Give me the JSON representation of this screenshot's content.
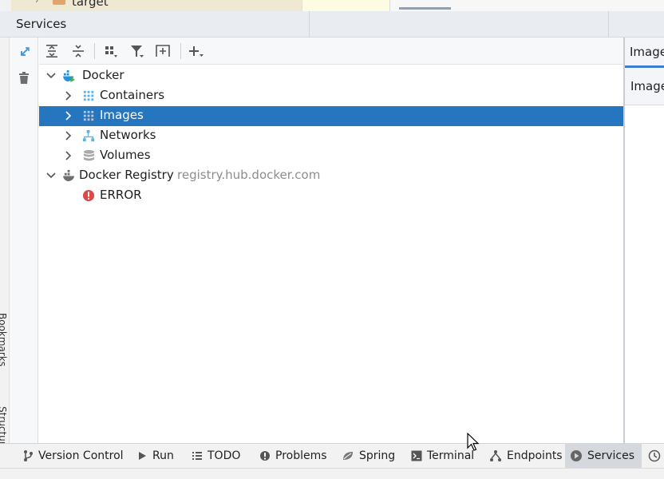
{
  "top_strip": {
    "folder_label": "target"
  },
  "services": {
    "title": "Services"
  },
  "left_stripe": {
    "bookmarks_label": "Bookmarks",
    "structure_label": "Structure"
  },
  "toolbar": {
    "buttons": [
      "expand-all",
      "collapse-all",
      "group-services",
      "filter",
      "new-service",
      "add"
    ]
  },
  "tree": {
    "docker": {
      "label": "Docker"
    },
    "containers": {
      "label": "Containers"
    },
    "images": {
      "label": "Images"
    },
    "networks": {
      "label": "Networks"
    },
    "volumes": {
      "label": "Volumes"
    },
    "registry": {
      "label": "Docker Registry",
      "url": "registry.hub.docker.com"
    },
    "error": {
      "label": "ERROR"
    }
  },
  "right_pane": {
    "tab_label": "Image",
    "header_label": "Image"
  },
  "bottom_tabs": {
    "version_control": "Version Control",
    "run": "Run",
    "todo": "TODO",
    "problems": "Problems",
    "spring": "Spring",
    "terminal": "Terminal",
    "endpoints": "Endpoints",
    "services": "Services"
  },
  "colors": {
    "selection": "#2675bf",
    "docker_blue": "#2d8fd5",
    "error_red": "#db4a4a",
    "header_bg": "#e9edf2"
  }
}
